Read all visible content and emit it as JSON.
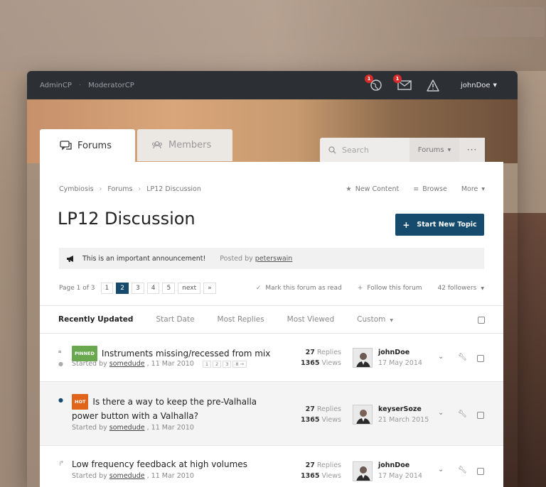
{
  "topbar": {
    "admin_link": "AdminCP",
    "separator": "·",
    "mod_link": "ModeratorCP",
    "notifications_badge": "1",
    "messages_badge": "1",
    "username": "johnDoe"
  },
  "tabs": {
    "forums": "Forums",
    "members": "Members"
  },
  "search": {
    "placeholder": "Search",
    "scope": "Forums",
    "more": "···"
  },
  "breadcrumb": [
    "Cymbiosis",
    "Forums",
    "LP12 Discussion"
  ],
  "page_actions": {
    "new_content": "New Content",
    "browse": "Browse",
    "more": "More"
  },
  "page_title": "LP12 Discussion",
  "start_button": "Start New Topic",
  "announcement": {
    "text": "This is an important announcement!",
    "posted_by_label": "Posted by",
    "author": "peterswain"
  },
  "pager": {
    "label": "Page 1 of 3",
    "pages": [
      "1",
      "2",
      "3",
      "4",
      "5"
    ],
    "active": "2",
    "next": "next",
    "last": "»",
    "mark_read": "Mark this forum as read",
    "follow": "Follow this forum",
    "followers": "42 followers"
  },
  "sort": {
    "recent": "Recently Updated",
    "start": "Start Date",
    "replies": "Most Replies",
    "viewed": "Most Viewed",
    "custom": "Custom"
  },
  "topics": [
    {
      "tag": "PINNED",
      "title": "Instruments missing/recessed from mix",
      "started_label": "Started by",
      "author": "somedude",
      "date": ", 11 Mar 2010",
      "mini_pages": [
        "1",
        "2",
        "3",
        "8 →"
      ],
      "replies": "27",
      "replies_label": "Replies",
      "views": "1365",
      "views_label": "Views",
      "last_poster": "johnDoe",
      "last_date": "17 May 2014"
    },
    {
      "tag": "HOT",
      "title": "Is there a way to keep the pre-Valhalla power button with a Valhalla?",
      "started_label": "Started by",
      "author": "somedude",
      "date": ", 11 Mar 2010",
      "replies": "27",
      "replies_label": "Replies",
      "views": "1365",
      "views_label": "Views",
      "last_poster": "keyserSoze",
      "last_date": "21 March 2015"
    },
    {
      "title": "Low frequency feedback at high volumes",
      "started_label": "Started by",
      "author": "somedude",
      "date": ", 11 Mar 2010",
      "replies": "27",
      "replies_label": "Replies",
      "views": "1365",
      "views_label": "Views",
      "last_poster": "johnDoe",
      "last_date": "17 May 2014"
    }
  ],
  "colors": {
    "primary": "#174b6e",
    "topbar": "#2c2f34",
    "pinned": "#6aa84f",
    "hot": "#e0651b",
    "badge": "#d42b2b"
  }
}
